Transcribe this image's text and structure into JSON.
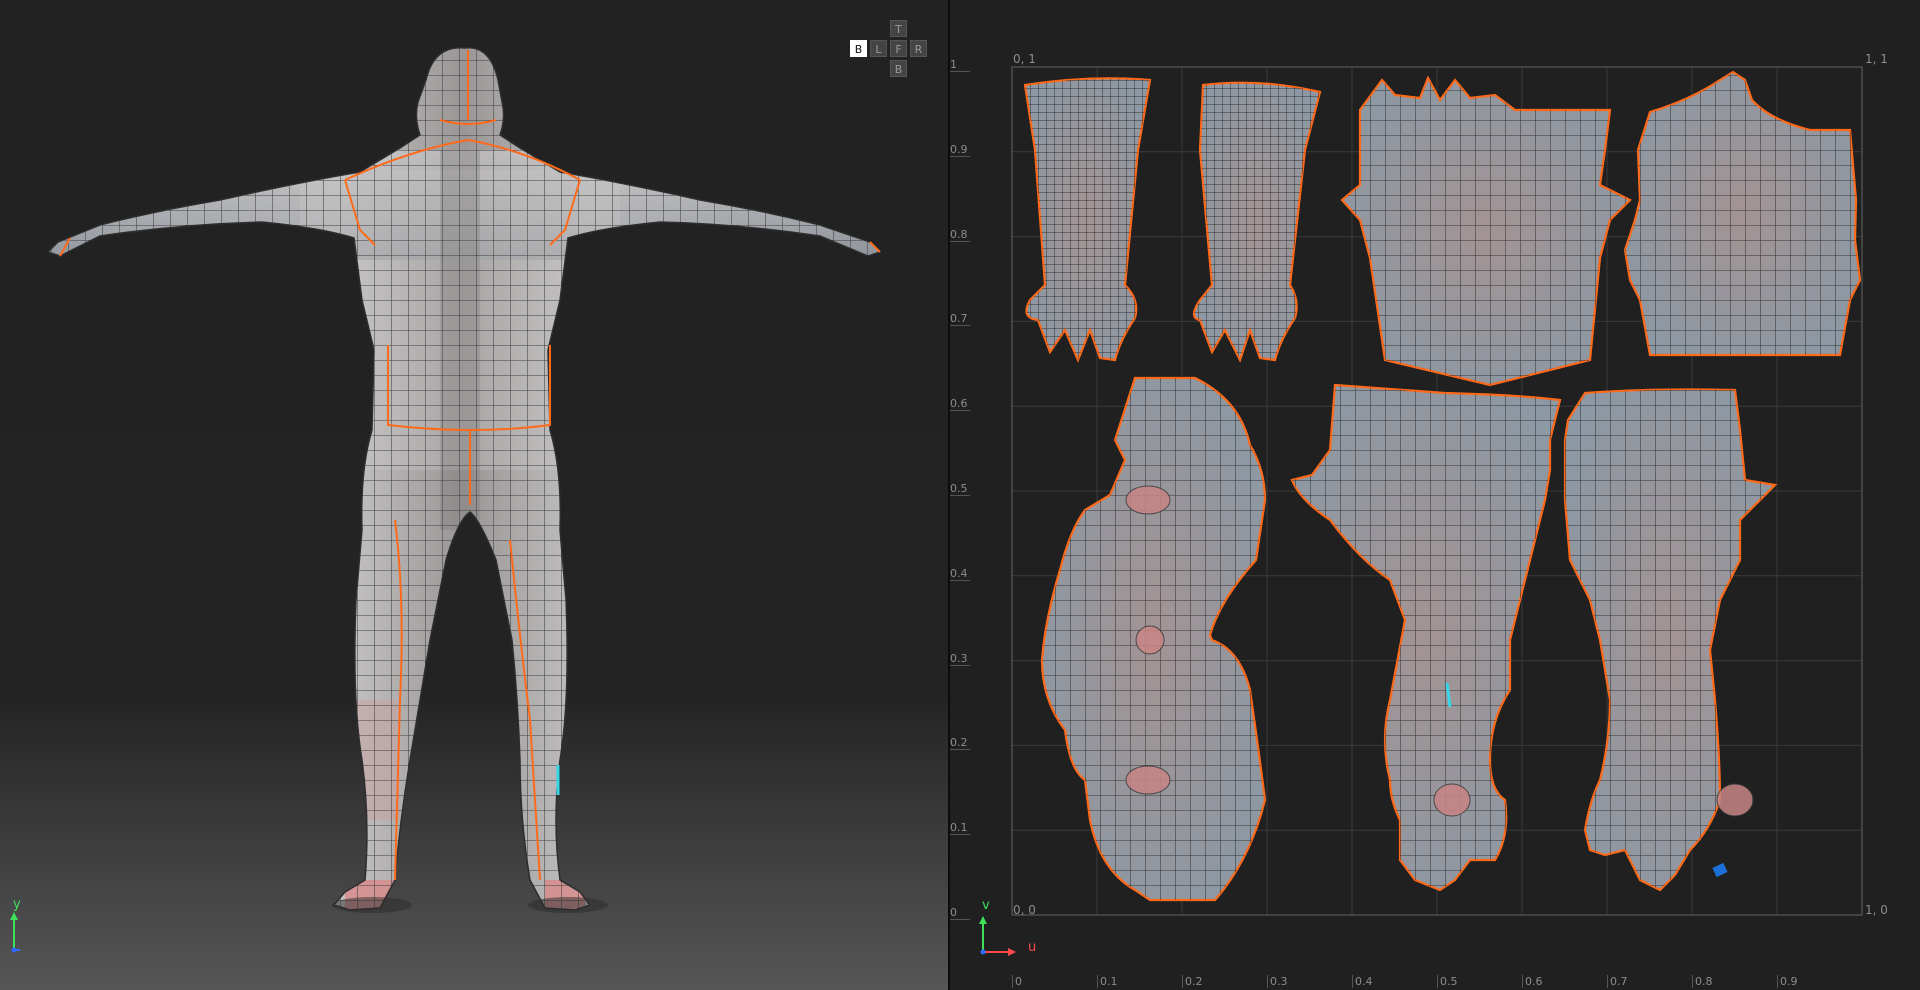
{
  "viewcube": {
    "front": "F",
    "top": "T",
    "left": "L",
    "right": "R",
    "bottom": "B",
    "back": "B"
  },
  "axes3d": {
    "y": "y"
  },
  "uvAxes": {
    "u": "u",
    "v": "v"
  },
  "uv": {
    "corners": {
      "topLeft": "0, 1",
      "topRight": "1, 1",
      "bottomLeft": "0, 0",
      "bottomRight": "1, 0"
    },
    "vTicks": [
      "1",
      "0.9",
      "0.8",
      "0.7",
      "0.6",
      "0.5",
      "0.4",
      "0.3",
      "0.2",
      "0.1",
      "0"
    ],
    "uTicks": [
      "0",
      "0.1",
      "0.2",
      "0.3",
      "0.4",
      "0.5",
      "0.6",
      "0.7",
      "0.8",
      "0.9"
    ]
  },
  "colors": {
    "seam": "#ff6a1a",
    "selectedEdge": "#35d6e8",
    "selectedFace": "#1a6fd8",
    "meshFill": "#8f979e",
    "wire": "#3a3a3a"
  }
}
